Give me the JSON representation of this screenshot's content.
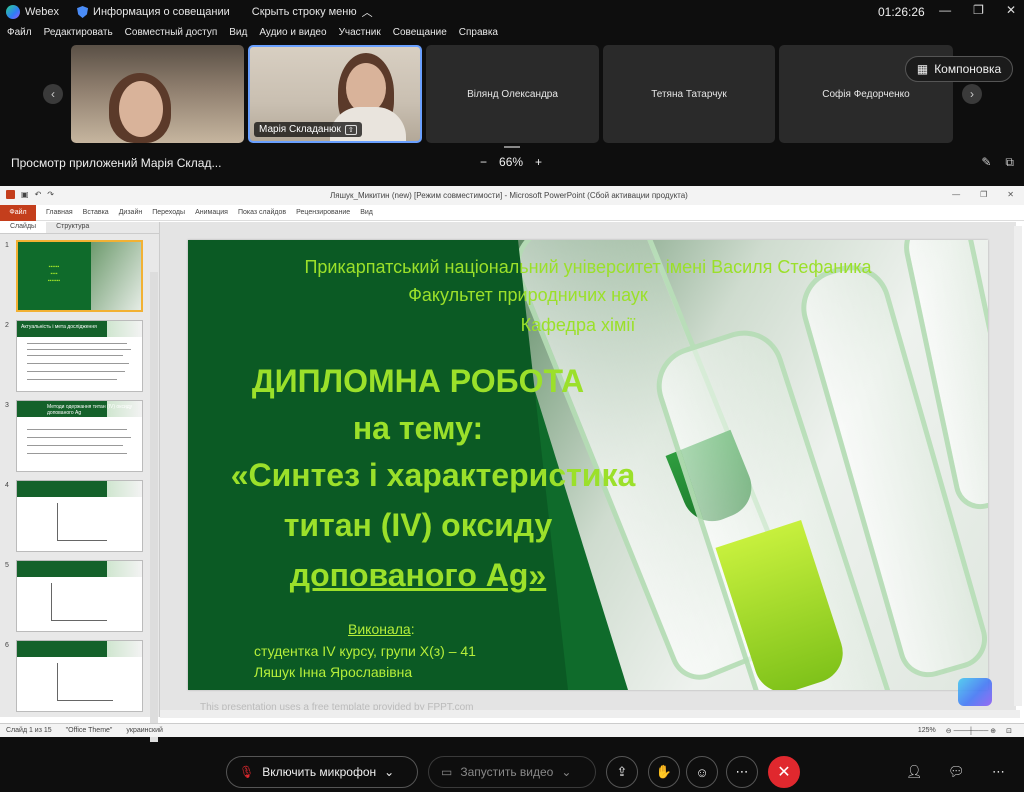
{
  "app": {
    "name": "Webex",
    "meeting_info": "Информация о совещании",
    "hide_menu": "Скрыть строку меню",
    "clock": "01:26:26"
  },
  "menu": [
    "Файл",
    "Редактировать",
    "Совместный доступ",
    "Вид",
    "Аудио и видео",
    "Участник",
    "Совещание",
    "Справка"
  ],
  "participants": [
    {
      "name": ""
    },
    {
      "name": "Марія Складанюк"
    },
    {
      "name": "Вілянд Олександра"
    },
    {
      "name": "Тетяна Татарчук"
    },
    {
      "name": "Софія Федорченко"
    }
  ],
  "layout_button": "Компоновка",
  "share_view": {
    "title": "Просмотр приложений Марія Склад...",
    "zoom": "66%",
    "minus": "−",
    "plus": "+"
  },
  "ppt": {
    "window_title": "Ляшук_Микитин (new) [Режим совместимости] - Microsoft PowerPoint (Сбой активации продукта)",
    "ribbon": [
      "Файл",
      "Главная",
      "Вставка",
      "Дизайн",
      "Переходы",
      "Анимация",
      "Показ слайдов",
      "Рецензирование",
      "Вид"
    ],
    "panel_tabs": [
      "Слайды",
      "Структура"
    ],
    "thumbs": [
      {
        "num": "1",
        "title": ""
      },
      {
        "num": "2",
        "title": "Актуальність і мета дослідження"
      },
      {
        "num": "3",
        "title": "Методи одержання титан (IV) оксиду допованого Ag"
      },
      {
        "num": "4",
        "title": ""
      },
      {
        "num": "5",
        "title": ""
      },
      {
        "num": "6",
        "title": ""
      }
    ],
    "status": {
      "slide": "Слайд 1 из 15",
      "theme": "\"Office Theme\"",
      "lang": "украинский",
      "zoom": "125%"
    },
    "watermark": "This presentation uses a free template provided by FPPT.com"
  },
  "slide": {
    "university": "Прикарпатський національний університет імені Василя Стефаника",
    "faculty": "Факультет природничих наук",
    "department": "Кафедра хімії",
    "work": "ДИПЛОМНА РОБОТА",
    "on_topic": "на тему:",
    "topic1": "«Синтез і характеристика",
    "topic2": "титан (IV) оксиду",
    "topic3": "допованого Ag»",
    "performed": "Виконала",
    "colon": ":",
    "student": "студентка IV курсу, групи Х(з) – 41",
    "name": "Ляшук Інна Ярославівна"
  },
  "controls": {
    "mic": "Включить микрофон",
    "video": "Запустить видео"
  },
  "colors": {
    "accent": "#9be02a",
    "slide_green": "#0b5a24",
    "end_call": "#e0282e"
  }
}
